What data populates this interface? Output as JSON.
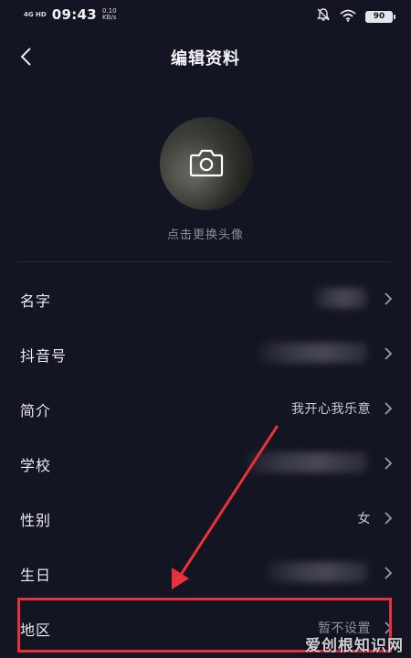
{
  "status_bar": {
    "network_type": "4G HD",
    "time": "09:43",
    "net_speed_value": "0.10",
    "net_speed_unit": "KB/s",
    "battery": "90"
  },
  "nav": {
    "title": "编辑资料"
  },
  "avatar": {
    "caption": "点击更换头像"
  },
  "fields": [
    {
      "label": "名字",
      "value": ""
    },
    {
      "label": "抖音号",
      "value": ""
    },
    {
      "label": "简介",
      "value": "我开心我乐意"
    },
    {
      "label": "学校",
      "value": ""
    },
    {
      "label": "性别",
      "value": "女"
    },
    {
      "label": "生日",
      "value": ""
    },
    {
      "label": "地区",
      "value": "暂不设置"
    }
  ],
  "watermark": "爱创根知识网",
  "colors": {
    "background": "#141522",
    "text_primary": "#e9e9ee",
    "text_secondary": "#8d8e99",
    "annotation_red": "#e9313b"
  },
  "icons": {
    "back": "chevron-left-icon",
    "camera": "camera-icon",
    "row_arrow": "chevron-right-icon",
    "mute": "bell-off-icon",
    "wifi": "wifi-icon",
    "battery": "battery-icon"
  }
}
